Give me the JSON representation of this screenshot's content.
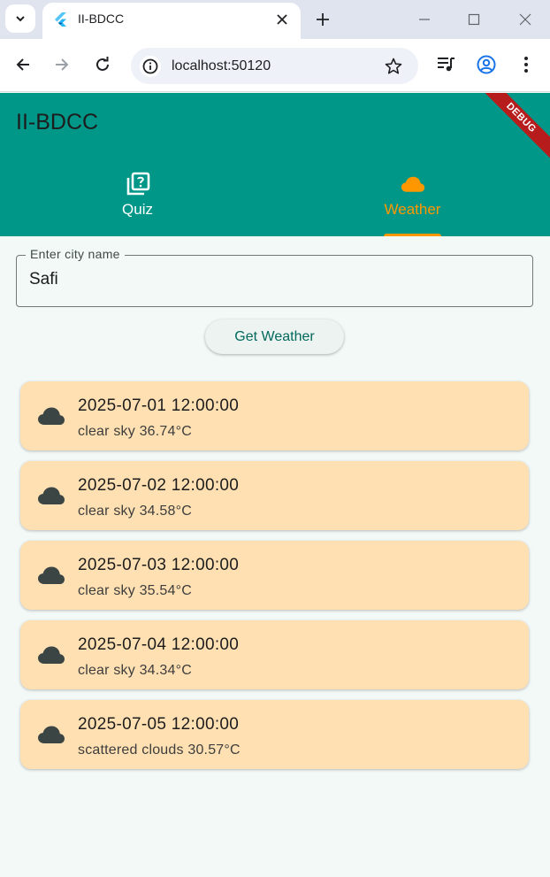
{
  "browser": {
    "tab_title": "II-BDCC",
    "url": "localhost:50120"
  },
  "app": {
    "title": "II-BDCC",
    "debug_banner": "DEBUG",
    "tabs": [
      {
        "label": "Quiz",
        "icon": "quiz-icon"
      },
      {
        "label": "Weather",
        "icon": "cloud-icon",
        "selected": true
      }
    ],
    "colors": {
      "primary": "#009688",
      "accent": "#ff9800",
      "card": "#ffe0b2"
    }
  },
  "form": {
    "city_label": "Enter city name",
    "city_value": "Safi",
    "button_label": "Get Weather"
  },
  "forecast": [
    {
      "date": "2025-07-01 12:00:00",
      "description": "clear sky 36.74°C"
    },
    {
      "date": "2025-07-02 12:00:00",
      "description": "clear sky 34.58°C"
    },
    {
      "date": "2025-07-03 12:00:00",
      "description": "clear sky 35.54°C"
    },
    {
      "date": "2025-07-04 12:00:00",
      "description": "clear sky 34.34°C"
    },
    {
      "date": "2025-07-05 12:00:00",
      "description": "scattered clouds 30.57°C"
    }
  ]
}
